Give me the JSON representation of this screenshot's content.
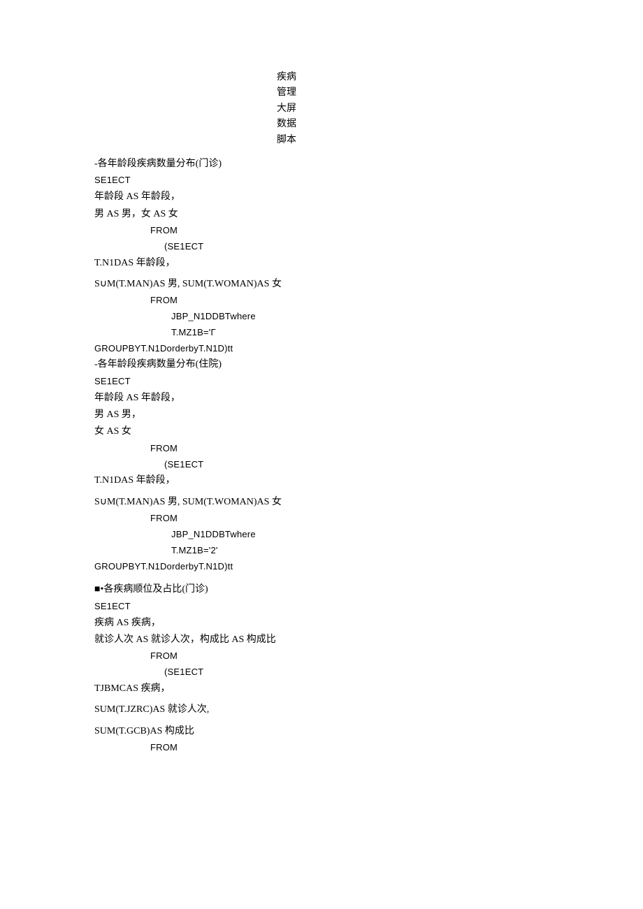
{
  "title": {
    "l1": "疾病",
    "l2": "管理",
    "l3": "大屏",
    "l4": "数据",
    "l5": "脚本"
  },
  "blocks": [
    {
      "heading": "-各年龄段疾病数量分布(门诊)",
      "lines": [
        {
          "text": "SE1ECT",
          "cls": "latin"
        },
        {
          "text": "年龄段 AS 年龄段，",
          "cls": ""
        },
        {
          "text": "男 AS 男，女 AS 女",
          "cls": ""
        },
        {
          "text": "FROM",
          "cls": "latin indent1"
        },
        {
          "text": "(SE1ECT",
          "cls": "latin indent2"
        },
        {
          "text": "T.N1DAS 年龄段，",
          "cls": ""
        },
        {
          "spacer": "sm"
        },
        {
          "text": "S∪M(T.MAN)AS 男, SUM(T.WOMAN)AS 女",
          "cls": ""
        },
        {
          "text": "FROM",
          "cls": "latin indent1"
        },
        {
          "text": "JBP_N1DDBTwhere",
          "cls": "latin indent3"
        },
        {
          "text": "T.MZ1B='Γ",
          "cls": "latin indent3"
        },
        {
          "text": "GROUPBYT.N1DorderbyT.N1D)tt",
          "cls": "latin"
        }
      ]
    },
    {
      "heading": "-各年龄段疾病数量分布(住院)",
      "lines": [
        {
          "text": "SE1ECT",
          "cls": "latin"
        },
        {
          "text": "年龄段 AS 年龄段，",
          "cls": ""
        },
        {
          "text": "男 AS 男，",
          "cls": ""
        },
        {
          "text": "女 AS 女",
          "cls": ""
        },
        {
          "text": "FROM",
          "cls": "latin indent1"
        },
        {
          "text": "(SE1ECT",
          "cls": "latin indent2"
        },
        {
          "text": "T.N1DAS 年龄段，",
          "cls": ""
        },
        {
          "spacer": "sm"
        },
        {
          "text": "S∪M(T.MAN)AS 男, SUM(T.WOMAN)AS 女",
          "cls": ""
        },
        {
          "text": "FROM",
          "cls": "latin indent1"
        },
        {
          "text": "JBP_N1DDBTwhere",
          "cls": "latin indent3"
        },
        {
          "text": "T.MZ1B='2'",
          "cls": "latin indent3"
        },
        {
          "text": "GROUPBYT.N1DorderbyT.N1D)tt",
          "cls": "latin"
        }
      ]
    },
    {
      "heading": "■•各疾病顺位及占比(门诊)",
      "lines": [
        {
          "text": "SE1ECT",
          "cls": "latin"
        },
        {
          "text": "疾病 AS 疾病，",
          "cls": ""
        },
        {
          "text": "就诊人次 AS 就诊人次，构成比 AS 构成比",
          "cls": ""
        },
        {
          "text": "FROM",
          "cls": "latin indent1"
        },
        {
          "text": "(SE1ECT",
          "cls": "latin indent2"
        },
        {
          "text": "TJBMCAS 疾病，",
          "cls": ""
        },
        {
          "spacer": "sm"
        },
        {
          "text": "SUM(T.JZRC)AS 就诊人次,",
          "cls": ""
        },
        {
          "spacer": "sm"
        },
        {
          "text": "SUM(T.GCB)AS 构成比",
          "cls": ""
        },
        {
          "text": "FROM",
          "cls": "latin indent1"
        }
      ]
    }
  ]
}
